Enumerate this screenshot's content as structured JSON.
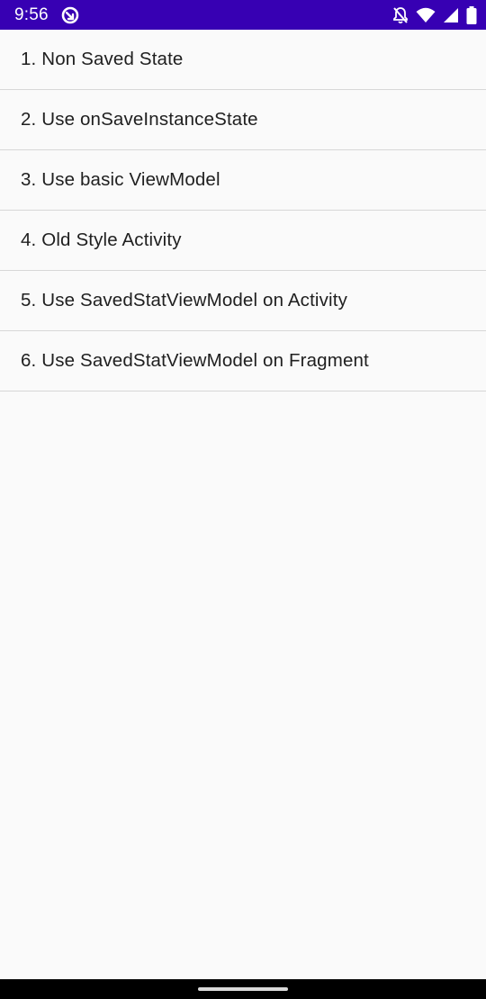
{
  "status_bar": {
    "time": "9:56",
    "background_color": "#3700b3",
    "icons": [
      "app-notification-icon",
      "notifications-off-icon",
      "wifi-icon",
      "cell-signal-icon",
      "battery-icon"
    ]
  },
  "list": {
    "items": [
      {
        "label": "1. Non Saved State"
      },
      {
        "label": "2. Use onSaveInstanceState"
      },
      {
        "label": "3. Use basic ViewModel"
      },
      {
        "label": "4. Old Style Activity"
      },
      {
        "label": "5. Use SavedStatViewModel on Activity"
      },
      {
        "label": "6. Use SavedStatViewModel on Fragment"
      }
    ]
  },
  "nav_bar": {
    "icons": [
      "home-handle"
    ]
  }
}
